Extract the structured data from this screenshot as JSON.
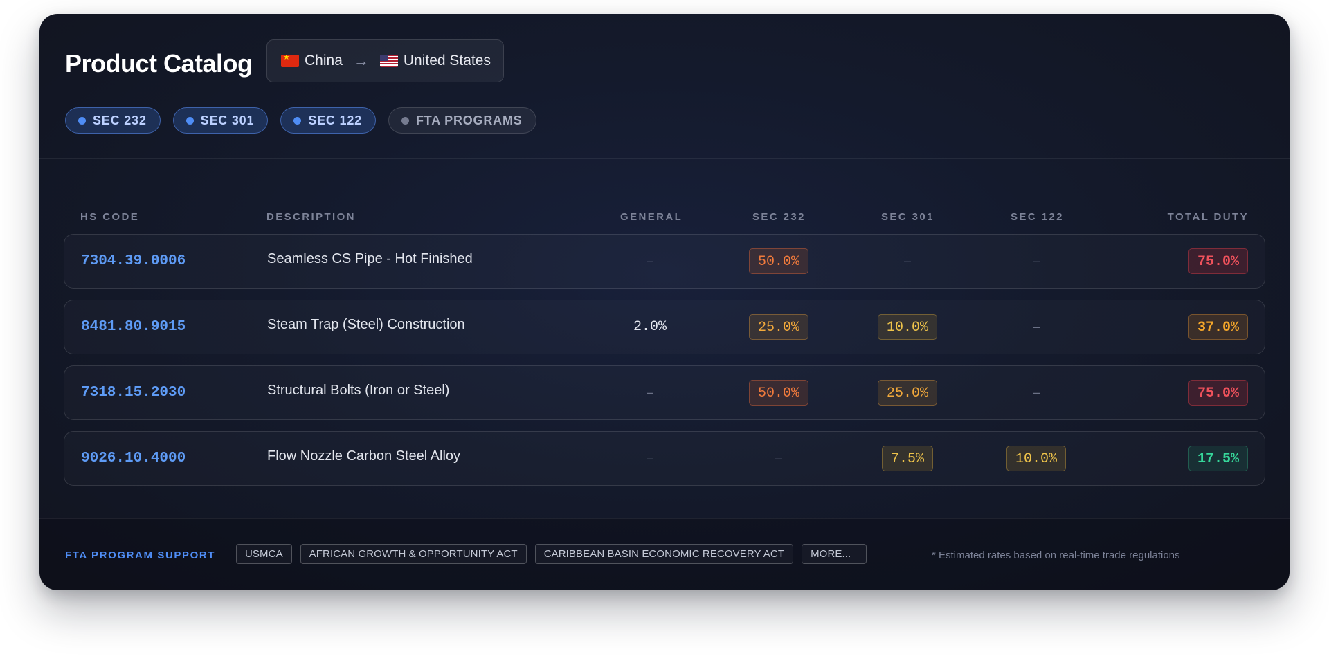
{
  "header": {
    "title": "Product Catalog",
    "route": {
      "origin": "China",
      "destination": "United States",
      "origin_flag": "cn-flag-icon",
      "destination_flag": "us-flag-icon",
      "arrow_icon": "arrow-right-icon"
    },
    "filters": [
      {
        "label": "SEC 232",
        "active": true
      },
      {
        "label": "SEC 301",
        "active": true
      },
      {
        "label": "SEC 122",
        "active": true
      },
      {
        "label": "FTA PROGRAMS",
        "active": false
      }
    ]
  },
  "table": {
    "columns": [
      "HS CODE",
      "DESCRIPTION",
      "GENERAL",
      "SEC 232",
      "SEC 301",
      "SEC 122",
      "TOTAL DUTY"
    ],
    "rows": [
      {
        "hs_code": "7304.39.0006",
        "description": "Seamless CS Pipe - Hot Finished",
        "general": "–",
        "sec232": "50.0%",
        "sec301": "–",
        "sec122": "–",
        "total": "75.0%"
      },
      {
        "hs_code": "8481.80.9015",
        "description": "Steam Trap (Steel) Construction",
        "general": "2.0%",
        "sec232": "25.0%",
        "sec301": "10.0%",
        "sec122": "–",
        "total": "37.0%"
      },
      {
        "hs_code": "7318.15.2030",
        "description": "Structural Bolts (Iron or Steel)",
        "general": "–",
        "sec232": "50.0%",
        "sec301": "25.0%",
        "sec122": "–",
        "total": "75.0%"
      },
      {
        "hs_code": "9026.10.4000",
        "description": "Flow Nozzle Carbon Steel Alloy",
        "general": "–",
        "sec232": "–",
        "sec301": "7.5%",
        "sec122": "10.0%",
        "total": "17.5%"
      }
    ]
  },
  "footer": {
    "label": "FTA PROGRAM SUPPORT",
    "programs": [
      "USMCA",
      "AFRICAN GROWTH & OPPORTUNITY ACT",
      "CARIBBEAN BASIN ECONOMIC RECOVERY ACT",
      "MORE..."
    ],
    "note": "* Estimated rates based on real-time trade regulations"
  },
  "colors": {
    "accent": "#4f8df5",
    "hs_code": "#5e9bf5",
    "high_duty": "#f0525c",
    "mid_duty": "#f4a62a",
    "low_duty": "#36d69a"
  }
}
